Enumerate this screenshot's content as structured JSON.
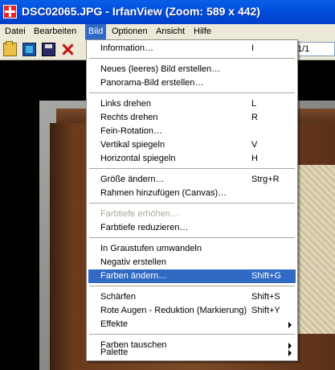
{
  "window": {
    "title": "DSC02065.JPG - IrfanView (Zoom: 589 x 442)"
  },
  "menubar": [
    "Datei",
    "Bearbeiten",
    "Bild",
    "Optionen",
    "Ansicht",
    "Hilfe"
  ],
  "toolbar": {
    "page_value": "1/1"
  },
  "dropdown": {
    "items": [
      {
        "label": "Information…",
        "shortcut": "I"
      },
      {
        "label": "Neues (leeres) Bild erstellen…",
        "shortcut": ""
      },
      {
        "label": "Panorama-Bild erstellen…",
        "shortcut": ""
      },
      {
        "label": "Links drehen",
        "shortcut": "L"
      },
      {
        "label": "Rechts drehen",
        "shortcut": "R"
      },
      {
        "label": "Fein-Rotation…",
        "shortcut": ""
      },
      {
        "label": "Vertikal spiegeln",
        "shortcut": "V"
      },
      {
        "label": "Horizontal spiegeln",
        "shortcut": "H"
      },
      {
        "label": "Größe ändern…",
        "shortcut": "Strg+R"
      },
      {
        "label": "Rahmen hinzufügen (Canvas)…",
        "shortcut": ""
      },
      {
        "label": "Farbtiefe erhöhen…",
        "shortcut": "",
        "state": "disabled"
      },
      {
        "label": "Farbtiefe reduzieren…",
        "shortcut": ""
      },
      {
        "label": "In Graustufen umwandeln",
        "shortcut": ""
      },
      {
        "label": "Negativ erstellen",
        "shortcut": ""
      },
      {
        "label": "Farben ändern…",
        "shortcut": "Shift+G",
        "state": "highlighted"
      },
      {
        "label": "Schärfen",
        "shortcut": "Shift+S"
      },
      {
        "label": "Rote Augen - Reduktion (Markierung)",
        "shortcut": "Shift+Y"
      },
      {
        "label": "Effekte",
        "shortcut": "",
        "submenu": true
      },
      {
        "label": "Farben tauschen",
        "shortcut": "",
        "submenu": true
      },
      {
        "label": "Palette",
        "shortcut": "",
        "submenu": true
      }
    ]
  },
  "colors": {
    "titlebar": "#0050e0",
    "menubar": "#ece9d8",
    "highlight": "#316ac5",
    "disabled_text": "#aca899"
  }
}
